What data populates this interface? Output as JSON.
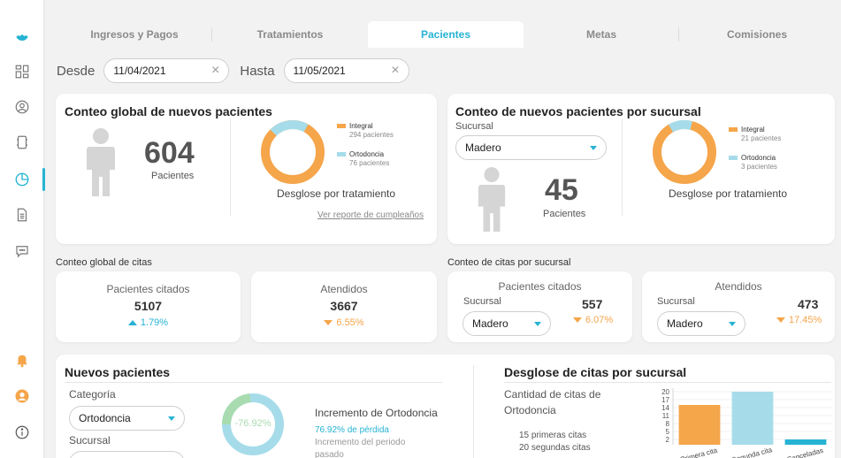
{
  "tabs": [
    {
      "label": "Ingresos y Pagos"
    },
    {
      "label": "Tratamientos"
    },
    {
      "label": "Pacientes"
    },
    {
      "label": "Metas"
    },
    {
      "label": "Comisiones"
    }
  ],
  "filters": {
    "from_label": "Desde",
    "from_value": "11/04/2021",
    "to_label": "Hasta",
    "to_value": "11/05/2021"
  },
  "global_new": {
    "title": "Conteo global de nuevos pacientes",
    "count": "604",
    "count_label": "Pacientes",
    "legend": [
      {
        "name": "Integral",
        "sub": "294 pacientes"
      },
      {
        "name": "Ortodoncia",
        "sub": "76 pacientes"
      }
    ],
    "donut_caption": "Desglose por tratamiento",
    "birthday_link": "Ver reporte de cumpleaños"
  },
  "branch_new": {
    "title": "Conteo de nuevos pacientes por sucursal",
    "branch_label": "Sucursal",
    "branch_value": "Madero",
    "count": "45",
    "count_label": "Pacientes",
    "legend": [
      {
        "name": "Integral",
        "sub": "21 pacientes"
      },
      {
        "name": "Ortodoncia",
        "sub": "3 pacientes"
      }
    ],
    "donut_caption": "Desglose por tratamiento"
  },
  "global_appts": {
    "section": "Conteo global de citas",
    "cited_title": "Pacientes citados",
    "cited_value": "5107",
    "cited_pct": "1.79%",
    "attended_title": "Atendidos",
    "attended_value": "3667",
    "attended_pct": "6.55%"
  },
  "branch_appts": {
    "section": "Conteo de citas por sucursal",
    "cited_title": "Pacientes citados",
    "cited_branch_label": "Sucursal",
    "cited_branch_value": "Madero",
    "cited_value": "557",
    "cited_pct": "6.07%",
    "attended_title": "Atendidos",
    "attended_branch_label": "Sucursal",
    "attended_branch_value": "Madero",
    "attended_value": "473",
    "attended_pct": "17.45%"
  },
  "new_patients": {
    "title": "Nuevos pacientes",
    "category_label": "Categoría",
    "category_value": "Ortodoncia",
    "branch_label": "Sucursal",
    "donut_value": "-76.92%",
    "increment_title": "Incremento de Ortodoncia",
    "loss_text": "76.92% de pérdida",
    "period_text_1": "Incremento del periodo",
    "period_text_2": "pasado"
  },
  "appt_breakdown": {
    "title": "Desglose de citas por sucursal",
    "subtitle_1": "Cantidad de citas de",
    "subtitle_2": "Ortodoncia",
    "line_1": "15 primeras citas",
    "line_2": "20 segundas citas"
  },
  "colors": {
    "accent": "#26b3d3",
    "orange": "#f5a54a",
    "light_blue": "#a6dcea",
    "green": "#a8dcb0"
  },
  "chart_data": {
    "type": "bar",
    "categories": [
      "Primera cita",
      "Segunda cita",
      "Canceladas"
    ],
    "values": [
      15,
      20,
      2
    ],
    "colors": [
      "#f5a54a",
      "#a6dcea",
      "#26b3d3"
    ],
    "ytick_labels": [
      "2",
      "5",
      "8",
      "11",
      "14",
      "17",
      "20"
    ],
    "ylim": [
      0,
      20
    ]
  }
}
